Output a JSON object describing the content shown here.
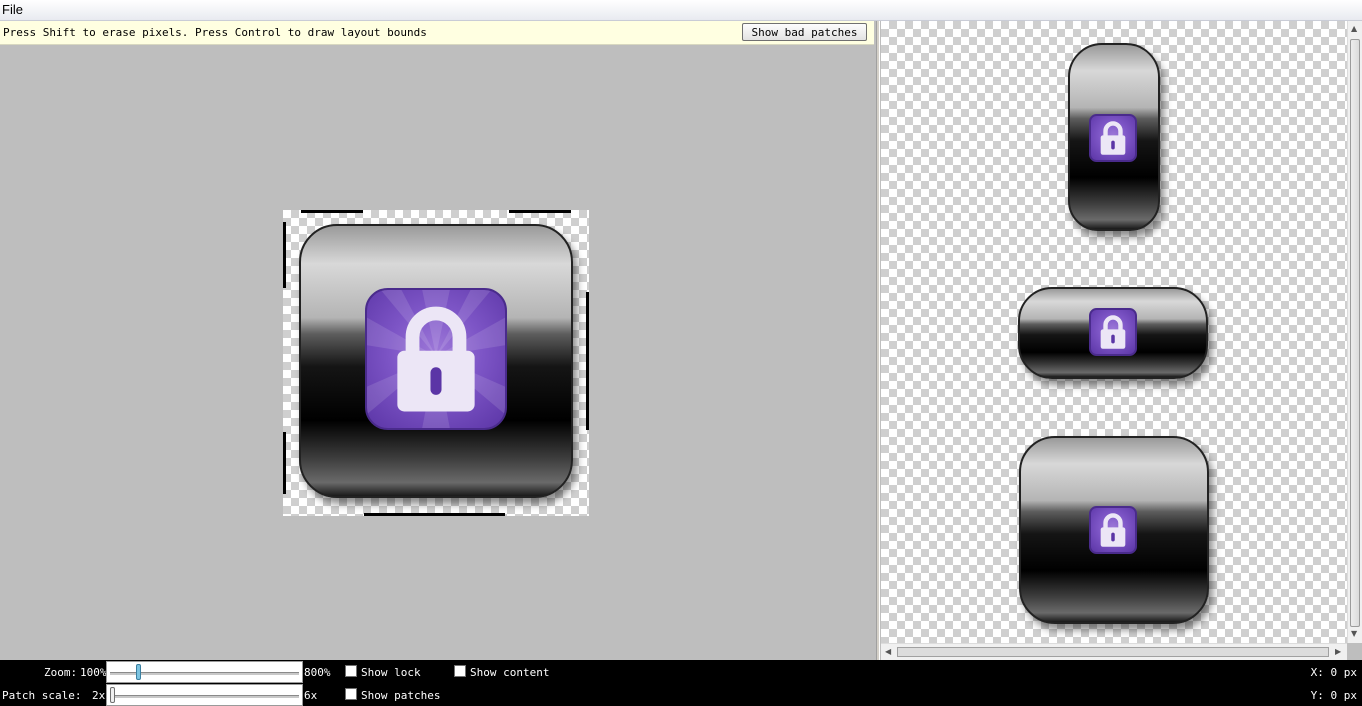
{
  "menu": {
    "file": "File"
  },
  "hint": "Press Shift to erase pixels. Press Control to draw layout bounds",
  "show_bad_patches": "Show bad patches",
  "zoom": {
    "label": "Zoom:",
    "min": "100%",
    "max": "800%",
    "value_fraction": 0.14
  },
  "patch_scale": {
    "label": "Patch scale:",
    "min": "2x",
    "max": "6x",
    "value_fraction": 0.0
  },
  "checkboxes": {
    "show_lock": {
      "label": "Show lock",
      "checked": false
    },
    "show_content": {
      "label": "Show content",
      "checked": false
    },
    "show_patches": {
      "label": "Show patches",
      "checked": false
    }
  },
  "coords": {
    "x": "X: 0 px",
    "y": "Y: 0 px"
  },
  "colors": {
    "lock_purple": "#7d55c6",
    "hint_bg": "#ffffe1",
    "status_bg": "#000000"
  },
  "icons": [
    "padlock-icon",
    "nine-patch-button-image"
  ]
}
